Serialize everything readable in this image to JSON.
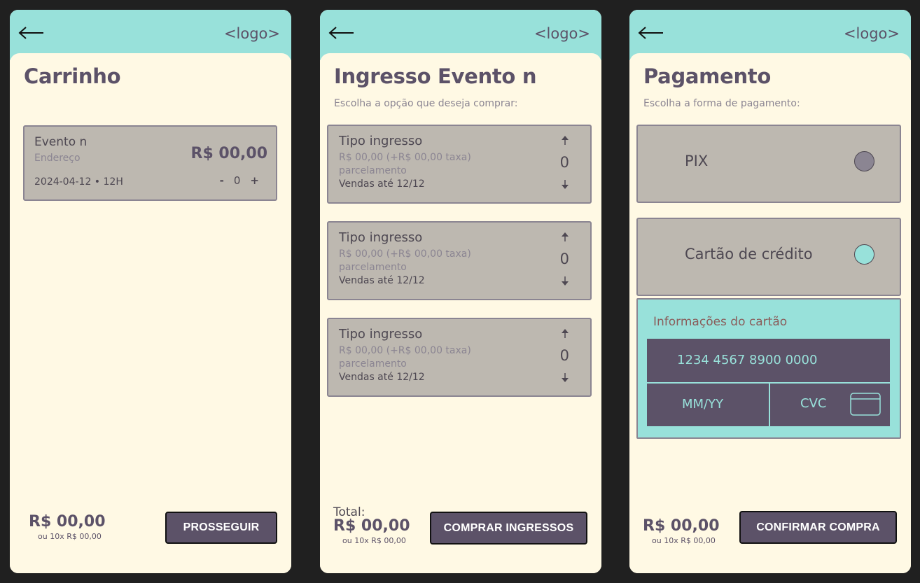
{
  "colors": {
    "background": "#202020",
    "screen": "#fff9e4",
    "header": "#98e1da",
    "accent_dark": "#5c5268",
    "card": "#bdb8b0",
    "card_border": "#8b8592",
    "radio_pix": "#8b8592",
    "radio_credit": "#98e1da"
  },
  "screens": {
    "cart": {
      "back_icon": "arrow-left-icon",
      "logo": "<logo>",
      "title": "Carrinho",
      "item": {
        "name": "Evento n",
        "address": "Endereço",
        "price": "R$ 00,00",
        "date": "2024-04-12 • 12H",
        "minus": "-",
        "qty": "0",
        "plus": "+"
      },
      "footer": {
        "price": "R$ 00,00",
        "installments": "ou 10x R$ 00,00",
        "button": "PROSSEGUIR"
      }
    },
    "tickets": {
      "back_icon": "arrow-left-icon",
      "logo": "<logo>",
      "title": "Ingresso Evento n",
      "subtitle": "Escolha a opção que deseja comprar:",
      "options": [
        {
          "name": "Tipo ingresso",
          "price": "R$ 00,00 (+R$ 00,00 taxa)",
          "installments": "parcelamento",
          "sales_until": "Vendas até 12/12",
          "qty": "0"
        },
        {
          "name": "Tipo ingresso",
          "price": "R$ 00,00 (+R$ 00,00 taxa)",
          "installments": "parcelamento",
          "sales_until": "Vendas até 12/12",
          "qty": "0"
        },
        {
          "name": "Tipo ingresso",
          "price": "R$ 00,00 (+R$ 00,00 taxa)",
          "installments": "parcelamento",
          "sales_until": "Vendas até 12/12",
          "qty": "0"
        }
      ],
      "footer": {
        "total_label": "Total:",
        "price": "R$ 00,00",
        "installments": "ou 10x R$ 00,00",
        "button": "COMPRAR INGRESSOS"
      }
    },
    "payment": {
      "back_icon": "arrow-left-icon",
      "logo": "<logo>",
      "title": "Pagamento",
      "subtitle": "Escolha a forma de pagamento:",
      "methods": [
        {
          "label": "PIX",
          "selected": false
        },
        {
          "label": "Cartão de crédito",
          "selected": true
        }
      ],
      "card_form": {
        "title": "Informações do cartão",
        "number_placeholder": "1234 4567 8900 0000",
        "expiry_placeholder": "MM/YY",
        "cvc_placeholder": "CVC",
        "card_icon": "credit-card-icon"
      },
      "footer": {
        "price": "R$ 00,00",
        "installments": "ou 10x R$ 00,00",
        "button": "CONFIRMAR COMPRA"
      }
    }
  }
}
